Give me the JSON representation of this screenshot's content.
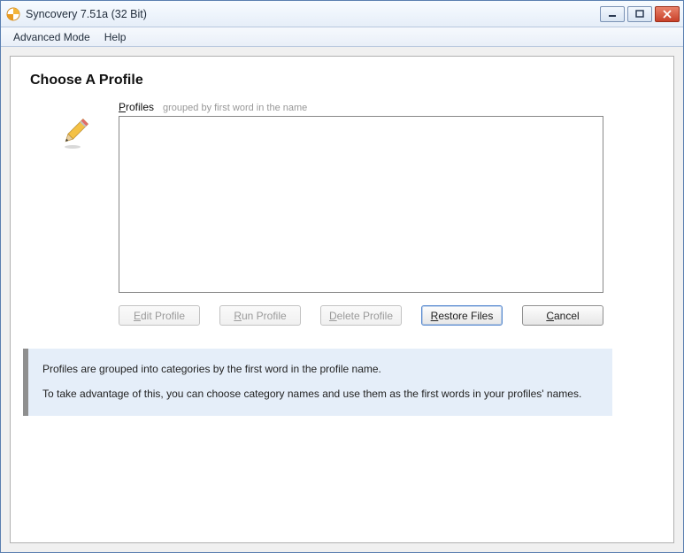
{
  "window": {
    "title": "Syncovery 7.51a (32 Bit)"
  },
  "menu": {
    "advanced_mode": "Advanced Mode",
    "help": "Help"
  },
  "heading": "Choose A Profile",
  "profiles": {
    "label_prefix": "P",
    "label_rest": "rofiles",
    "hint": "grouped by first word in the name"
  },
  "buttons": {
    "edit_u": "E",
    "edit_rest": "dit Profile",
    "run_u": "R",
    "run_rest": "un Profile",
    "delete_u": "D",
    "delete_rest": "elete Profile",
    "restore_u": "R",
    "restore_rest": "estore Files",
    "cancel_u": "C",
    "cancel_rest": "ancel"
  },
  "info": {
    "line1": "Profiles are grouped into categories by the first word in the profile name.",
    "line2": "To take advantage of this, you can choose category names and use them as the first words in your profiles' names."
  }
}
